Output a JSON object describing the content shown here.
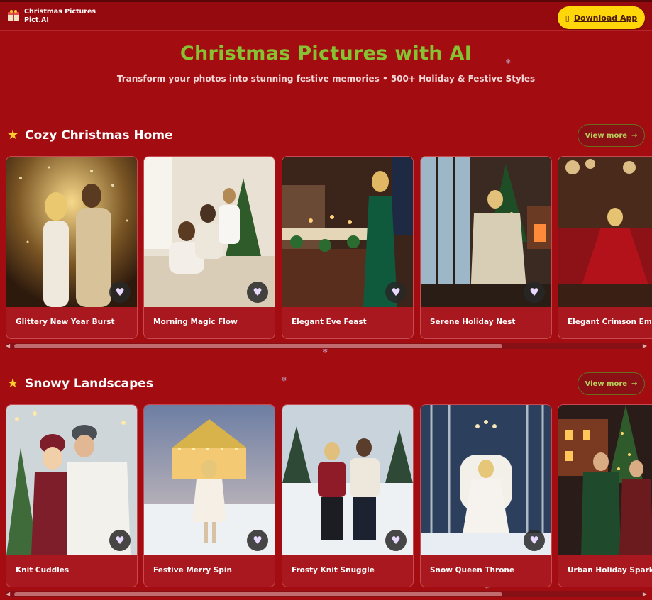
{
  "header": {
    "brand_line1": "Christmas Pictures",
    "brand_line2": "Pict.AI",
    "download_label": "Download App",
    "logo_icon": "gift-logo-icon",
    "download_icon": "phone-icon"
  },
  "hero": {
    "title": "Christmas Pictures with AI",
    "subtitle": "Transform your photos into stunning festive memories • 500+ Holiday & Festive Styles"
  },
  "sections": [
    {
      "title": "Cozy Christmas Home",
      "view_more": "View more",
      "cards": [
        {
          "name": "Glittery New Year Burst"
        },
        {
          "name": "Morning Magic Flow"
        },
        {
          "name": "Elegant Eve Feast"
        },
        {
          "name": "Serene Holiday Nest"
        },
        {
          "name": "Elegant Crimson Em"
        }
      ]
    },
    {
      "title": "Snowy Landscapes",
      "view_more": "View more",
      "cards": [
        {
          "name": "Knit Cuddles"
        },
        {
          "name": "Festive Merry Spin"
        },
        {
          "name": "Frosty Knit Snuggle"
        },
        {
          "name": "Snow Queen Throne"
        },
        {
          "name": "Urban Holiday Spark"
        }
      ]
    }
  ],
  "colors": {
    "background": "#a30d12",
    "accent_title": "#86c232",
    "download_button": "#ffd60a"
  }
}
